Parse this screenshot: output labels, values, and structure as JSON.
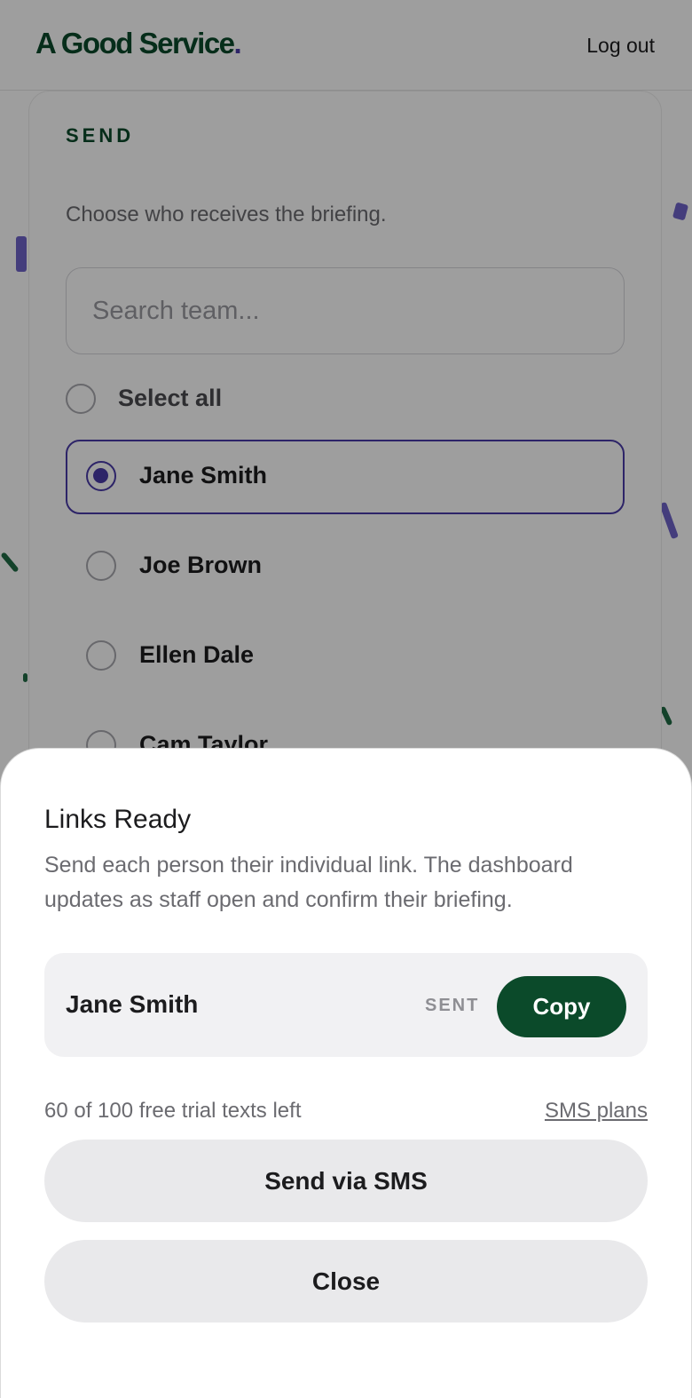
{
  "header": {
    "brand": "A Good Service",
    "brand_dot": ".",
    "logout_label": "Log out"
  },
  "send_panel": {
    "section_title": "SEND",
    "instructions": "Choose who receives the briefing.",
    "search_placeholder": "Search team...",
    "select_all_label": "Select all",
    "members": [
      {
        "name": "Jane Smith",
        "selected": true
      },
      {
        "name": "Joe Brown",
        "selected": false
      },
      {
        "name": "Ellen Dale",
        "selected": false
      },
      {
        "name": "Cam Taylor",
        "selected": false
      }
    ]
  },
  "sheet": {
    "title": "Links Ready",
    "description": "Send each person their individual link. The dashboard updates as staff open and confirm their briefing.",
    "links": [
      {
        "name": "Jane Smith",
        "status": "SENT",
        "action": "Copy"
      }
    ],
    "trial_text": "60 of 100 free trial texts left",
    "plans_link": "SMS plans",
    "send_sms_label": "Send via SMS",
    "close_label": "Close"
  },
  "colors": {
    "brand_green": "#0b4a2a",
    "accent_purple": "#4a3aa8",
    "overlay": "rgba(0,0,0,0.38)"
  }
}
